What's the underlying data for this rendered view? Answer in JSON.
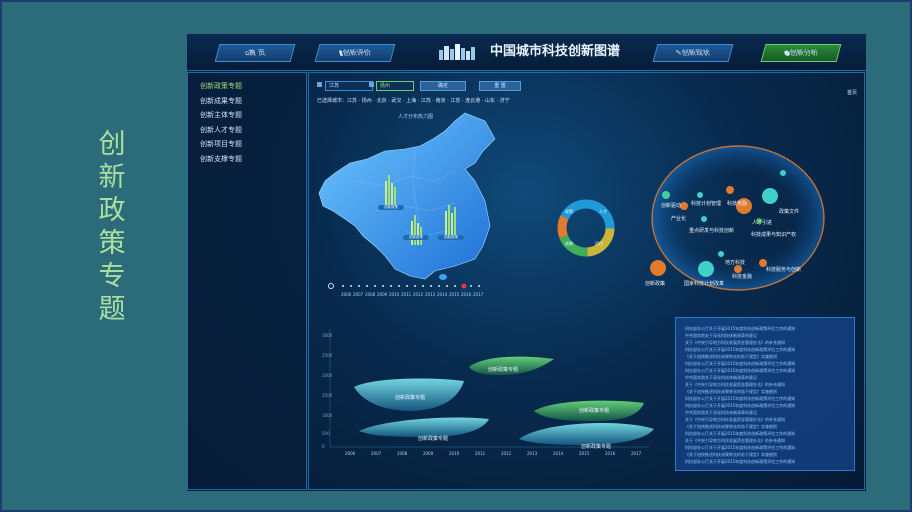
{
  "side_title": [
    "创",
    "新",
    "政",
    "策",
    "专",
    "题"
  ],
  "header": {
    "title": "中国城市科技创新图谱",
    "nav": [
      "首 页",
      "创新评价",
      "创新现状",
      "创新分析"
    ],
    "corner_label": "首页"
  },
  "sidebar": {
    "items": [
      "创新政策专题",
      "创新成果专题",
      "创新主体专题",
      "创新人才专题",
      "创新项目专题",
      "创新支撑专题"
    ]
  },
  "filters": {
    "input1": "江苏",
    "input2": "扬州",
    "btn1": "确定",
    "btn2": "重 置",
    "selected_cities": "已选择城市：江苏 · 扬州 · 北京 · 武汉 · 上海 · 江苏 · 南京 · 江苏 · 连云港 · 山东 · 济宁"
  },
  "map": {
    "title": "人才分布热力图",
    "bar_tags": [
      "创新政策",
      "创新政策",
      "创新政策"
    ]
  },
  "donut": {
    "segments": [
      "政策",
      "人才",
      "项目",
      "成果"
    ],
    "colors": [
      "#1f9ad6",
      "#c9b53a",
      "#3fae5a",
      "#e07a2c"
    ]
  },
  "timeline": {
    "years": [
      "2006",
      "2007",
      "2008",
      "2009",
      "2010",
      "2011",
      "2012",
      "2013",
      "2014",
      "2015",
      "2016",
      "2017"
    ],
    "active": "2015"
  },
  "bubbles": [
    {
      "label": "创新驱动",
      "color": "#3fd0a0"
    },
    {
      "label": "科技计划管理",
      "color": "#3fd0c8"
    },
    {
      "label": "科技奖励",
      "color": "#e07a2c"
    },
    {
      "label": "政策文件",
      "color": "#3fd0c8"
    },
    {
      "label": "人才引进",
      "color": "#e07a2c"
    },
    {
      "label": "产业化",
      "color": "#e07a2c"
    },
    {
      "label": "重点研发与科技创新",
      "color": "#3fd0c8"
    },
    {
      "label": "科技成果与知识产权",
      "color": "#3fae5a"
    },
    {
      "label": "地方科技",
      "color": "#3fd0c8"
    },
    {
      "label": "科技金融",
      "color": "#e07a2c"
    },
    {
      "label": "科技服务与创新",
      "color": "#e07a2c"
    },
    {
      "label": "创新政策",
      "color": "#e07a2c"
    },
    {
      "label": "国家科技计划改革",
      "color": "#3fd0c8"
    }
  ],
  "blobs": [
    "创新政策专题",
    "创新政策专题",
    "创新政策专题",
    "创新政策专题",
    "创新政策专题"
  ],
  "x_axis": [
    "2006",
    "2007",
    "2008",
    "2009",
    "2010",
    "2011",
    "2012",
    "2013",
    "2014",
    "2015",
    "2016",
    "2017"
  ],
  "y_axis": [
    "3000",
    "2500",
    "2000",
    "1500",
    "1000",
    "500",
    "0"
  ],
  "news": [
    "科技部办公厅关于开展2015年度科技创新政策评估工作的通知",
    "中共国务院关于深化科技体制改革的意见",
    "关于《中央引导地方科技发展资金管理办法》的补充通知",
    "科技部办公厅关于开展2015年度科技创新政策评估工作的通知",
    "《关于加快推进科技成果转化的若干规定》实施细则",
    "科技部办公厅关于开展2015年度科技创新政策评估工作的通知",
    "科技部办公厅关于开展2015年度科技创新政策评估工作的通知",
    "中共国务院关于深化科技体制改革的意见",
    "关于《中央引导地方科技发展资金管理办法》的补充通知",
    "《关于加快推进科技成果转化的若干规定》实施细则",
    "科技部办公厅关于开展2015年度科技创新政策评估工作的通知",
    "科技部办公厅关于开展2015年度科技创新政策评估工作的通知",
    "中共国务院关于深化科技体制改革的意见",
    "关于《中央引导地方科技发展资金管理办法》的补充通知",
    "《关于加快推进科技成果转化的若干规定》实施细则",
    "科技部办公厅关于开展2015年度科技创新政策评估工作的通知",
    "关于《中央引导地方科技发展资金管理办法》的补充通知",
    "科技部办公厅关于开展2015年度科技创新政策评估工作的通知",
    "《关于加快推进科技成果转化的若干规定》实施细则",
    "科技部办公厅关于开展2015年度科技创新政策评估工作的通知"
  ]
}
